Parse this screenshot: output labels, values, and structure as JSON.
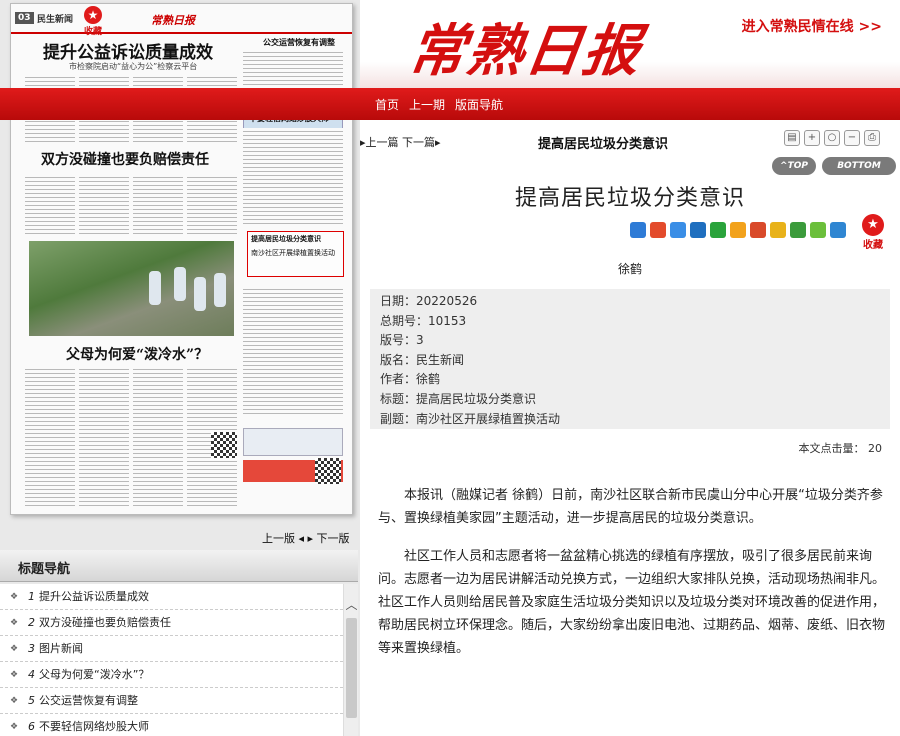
{
  "banner": {
    "logo_text": "常熟日报",
    "enter_link": "进入常熟民情在线 >>"
  },
  "nav": {
    "home": "首页",
    "prev_issue": "上一期",
    "layout_nav": "版面导航"
  },
  "paper": {
    "page_number": "03",
    "section": "民生新闻",
    "favorite": "收藏",
    "mast": "常熟日报",
    "headline": "提升公益诉讼质量成效",
    "subheadline": "市检察院启动“益心为公”检察云平台",
    "headline2": "双方没碰撞也要负赔偿责任",
    "headline3": "父母为何爱“泼冷水”？",
    "right_col_title": "公交运营恢复有调整",
    "right_headline": "不要轻信网络炒股大师",
    "highlight_title": "提高居民垃圾分类意识",
    "highlight_sub": "南沙社区开展绿植置换活动"
  },
  "page_nav": "上一版 ◂ ▸ 下一版",
  "title_nav": {
    "heading": "标题导航",
    "items": [
      {
        "num": "1",
        "label": "提升公益诉讼质量成效"
      },
      {
        "num": "2",
        "label": "双方没碰撞也要负赔偿责任"
      },
      {
        "num": "3",
        "label": "图片新闻"
      },
      {
        "num": "4",
        "label": "父母为何爱“泼冷水”？"
      },
      {
        "num": "5",
        "label": "公交运营恢复有调整"
      },
      {
        "num": "6",
        "label": "不要轻信网络炒股大师"
      }
    ]
  },
  "article_toolbar": {
    "prev_next": "▸上一篇 下一篇▸",
    "title": "提高居民垃圾分类意识",
    "top_btn": "^TOP",
    "bottom_btn": "BOTTOM"
  },
  "article": {
    "title": "提高居民垃圾分类意识",
    "favorite": "收藏",
    "author": "徐鹤",
    "meta": [
      {
        "key": "日期：",
        "value": "20220526"
      },
      {
        "key": "总期号：",
        "value": "10153"
      },
      {
        "key": "版号：",
        "value": "3"
      },
      {
        "key": "版名：",
        "value": "民生新闻"
      },
      {
        "key": "作者：",
        "value": "徐鹤"
      },
      {
        "key": "标题：",
        "value": "提高居民垃圾分类意识"
      },
      {
        "key": "副题：",
        "value": "南沙社区开展绿植置换活动"
      }
    ],
    "hits": "本文点击量： 20",
    "paragraphs": [
      "本报讯（融媒记者 徐鹤）日前，南沙社区联合新市民虞山分中心开展“垃圾分类齐参与、置换绿植美家园”主题活动，进一步提高居民的垃圾分类意识。",
      "社区工作人员和志愿者将一盆盆精心挑选的绿植有序摆放，吸引了很多居民前来询问。志愿者一边为居民讲解活动兑换方式，一边组织大家排队兑换，活动现场热闹非凡。社区工作人员则给居民普及家庭生活垃圾分类知识以及垃圾分类对环境改善的促进作用，帮助居民树立环保理念。随后，大家纷纷拿出废旧电池、过期药品、烟蒂、废纸、旧衣物等来置换绿植。"
    ]
  },
  "colors": {
    "brand_red": "#d40f0f",
    "meta_bg": "#eeeeee"
  }
}
